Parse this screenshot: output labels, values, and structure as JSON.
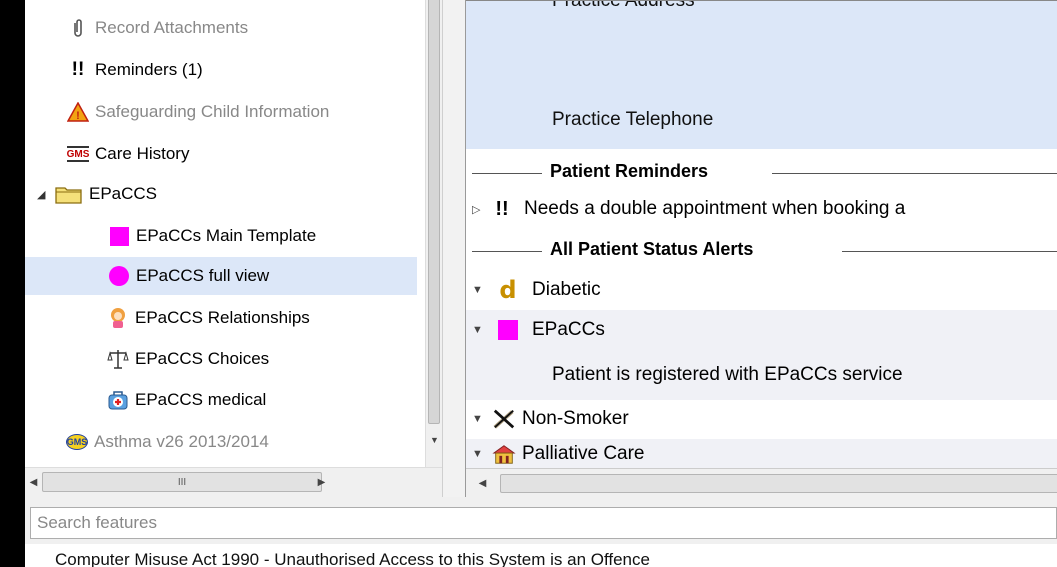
{
  "nav": {
    "items": [
      {
        "label": "Record Attachments",
        "icon": "paperclip-icon",
        "dimmed": true
      },
      {
        "label": "Reminders (1)",
        "icon": "double-exclamation-icon"
      },
      {
        "label": "Safeguarding Child Information",
        "icon": "warning-triangle-icon",
        "dimmed": true
      },
      {
        "label": "Care History",
        "icon": "gms-icon",
        "icon_text": "GMS"
      },
      {
        "label": "EPaCCS",
        "icon": "folder-icon",
        "expanded": true
      },
      {
        "label": "EPaCCs Main Template",
        "icon": "magenta-square-icon"
      },
      {
        "label": "EPaCCS full view",
        "icon": "magenta-circle-icon",
        "selected": true
      },
      {
        "label": "EPaCCS Relationships",
        "icon": "person-icon"
      },
      {
        "label": "EPaCCS Choices",
        "icon": "scales-icon"
      },
      {
        "label": "EPaCCS medical",
        "icon": "medical-bag-icon"
      },
      {
        "label": "Asthma v26 2013/2014",
        "icon": "gms-badge-icon",
        "icon_text": "GMS",
        "dimmed": true
      }
    ],
    "scroll_thumb_grip": "III"
  },
  "summary": {
    "practice_address_label": "Practice Address",
    "practice_telephone_label": "Practice Telephone",
    "patient_reminders_title": "Patient Reminders",
    "reminder_text": "Needs a double appointment when booking a",
    "status_alerts_title": "All Patient Status Alerts",
    "alerts": [
      {
        "label": "Diabetic",
        "icon": "diabetic-d-icon",
        "icon_text": "d"
      },
      {
        "label": "EPaCCs",
        "icon": "magenta-square-icon",
        "detail": "Patient is registered with EPaCCs service"
      },
      {
        "label": "Non-Smoker",
        "icon": "no-smoking-icon"
      },
      {
        "label": "Palliative Care",
        "icon": "palliative-care-icon"
      }
    ]
  },
  "search": {
    "placeholder": "Search features"
  },
  "warning_text": "Computer Misuse Act 1990 - Unauthorised Access to this System is an Offence",
  "colors": {
    "selection": "#dce7f8",
    "epaccs_magenta": "#ff00ff",
    "diabetic_gold": "#c89000"
  }
}
